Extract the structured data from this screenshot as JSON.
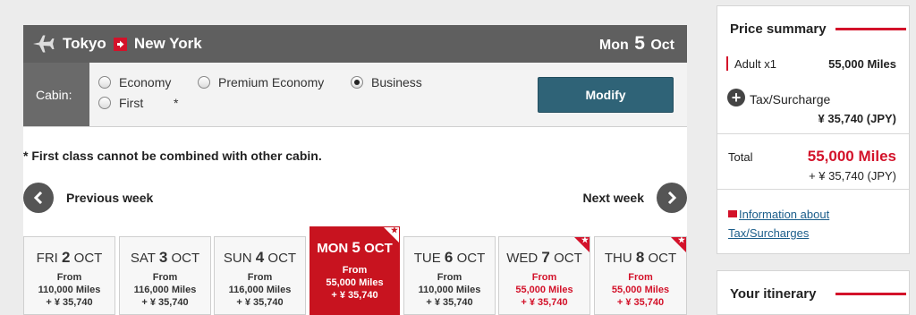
{
  "route": {
    "origin": "Tokyo",
    "destination": "New York",
    "weekday": "Mon",
    "day": "5",
    "month": "Oct"
  },
  "cabin": {
    "label": "Cabin:",
    "options": [
      {
        "label": "Economy",
        "selected": false
      },
      {
        "label": "Premium Economy",
        "selected": false
      },
      {
        "label": "Business",
        "selected": true
      },
      {
        "label": "First",
        "selected": false
      }
    ],
    "first_asterisk": "*",
    "modify_label": "Modify"
  },
  "note": "* First class cannot be combined with other cabin.",
  "week_nav": {
    "prev_label": "Previous week",
    "next_label": "Next week",
    "prev_icon": "chevron-left-icon",
    "next_icon": "chevron-right-icon"
  },
  "days": [
    {
      "weekday": "FRI",
      "day": "2",
      "month": "OCT",
      "from": "From",
      "miles": "110,000 Miles",
      "tax": "+ ¥ 35,740",
      "highlight": false,
      "selected": false
    },
    {
      "weekday": "SAT",
      "day": "3",
      "month": "OCT",
      "from": "From",
      "miles": "116,000 Miles",
      "tax": "+ ¥ 35,740",
      "highlight": false,
      "selected": false
    },
    {
      "weekday": "SUN",
      "day": "4",
      "month": "OCT",
      "from": "From",
      "miles": "116,000 Miles",
      "tax": "+ ¥ 35,740",
      "highlight": false,
      "selected": false
    },
    {
      "weekday": "MON",
      "day": "5",
      "month": "OCT",
      "from": "From",
      "miles": "55,000 Miles",
      "tax": "+ ¥ 35,740",
      "highlight": true,
      "selected": true
    },
    {
      "weekday": "TUE",
      "day": "6",
      "month": "OCT",
      "from": "From",
      "miles": "110,000 Miles",
      "tax": "+ ¥ 35,740",
      "highlight": false,
      "selected": false
    },
    {
      "weekday": "WED",
      "day": "7",
      "month": "OCT",
      "from": "From",
      "miles": "55,000 Miles",
      "tax": "+ ¥ 35,740",
      "highlight": true,
      "selected": false
    },
    {
      "weekday": "THU",
      "day": "8",
      "month": "OCT",
      "from": "From",
      "miles": "55,000 Miles",
      "tax": "+ ¥ 35,740",
      "highlight": true,
      "selected": false
    }
  ],
  "price_summary": {
    "title": "Price summary",
    "adult_label": "Adult x1",
    "adult_miles": "55,000 Miles",
    "tax_label": "Tax/Surcharge",
    "tax_value": "¥ 35,740 (JPY)",
    "total_label": "Total",
    "total_miles": "55,000 Miles",
    "total_tax": "+ ¥ 35,740 (JPY)",
    "info_link": "Information about Tax/Surcharges"
  },
  "itinerary": {
    "title": "Your itinerary"
  },
  "colors": {
    "brand_red": "#d3122a",
    "modify_blue": "#2f6377",
    "header_gray": "#5f5f5f"
  }
}
